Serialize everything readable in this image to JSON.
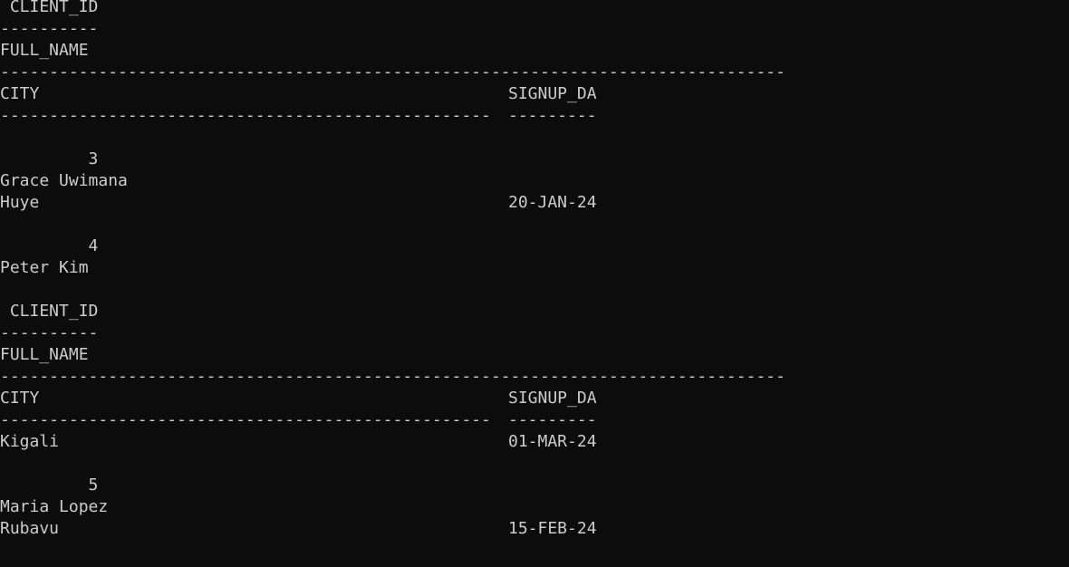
{
  "terminal": {
    "text_color": "#cccccc",
    "background_color": "#0c0c0c",
    "lines": [
      [
        " CLIENT_ID"
      ],
      [
        "----------"
      ],
      [
        "FULL_NAME"
      ],
      [
        "--------------------------------------------------------------------------------"
      ],
      [
        "CITY",
        "SIGNUP_DA"
      ],
      [
        "--------------------------------------------------",
        "---------"
      ],
      [],
      [
        "         3"
      ],
      [
        "Grace Uwimana"
      ],
      [
        "Huye",
        "20-JAN-24"
      ],
      [],
      [
        "         4"
      ],
      [
        "Peter Kim"
      ],
      [],
      [
        " CLIENT_ID"
      ],
      [
        "----------"
      ],
      [
        "FULL_NAME"
      ],
      [
        "--------------------------------------------------------------------------------"
      ],
      [
        "CITY",
        "SIGNUP_DA"
      ],
      [
        "--------------------------------------------------",
        "---------"
      ],
      [
        "Kigali",
        "01-MAR-24"
      ],
      [],
      [
        "         5"
      ],
      [
        "Maria Lopez"
      ],
      [
        "Rubavu",
        "15-FEB-24"
      ]
    ]
  }
}
